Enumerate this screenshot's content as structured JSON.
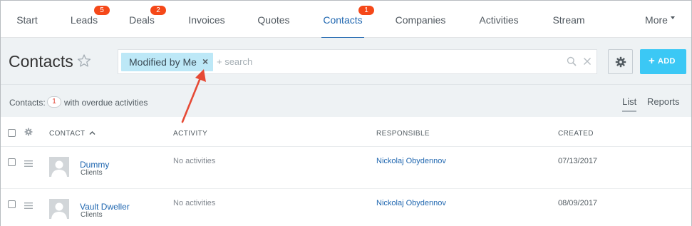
{
  "nav": {
    "items": [
      {
        "label": "Start"
      },
      {
        "label": "Leads",
        "badge": "5"
      },
      {
        "label": "Deals",
        "badge": "2"
      },
      {
        "label": "Invoices"
      },
      {
        "label": "Quotes"
      },
      {
        "label": "Contacts",
        "badge": "1",
        "active": true
      },
      {
        "label": "Companies"
      },
      {
        "label": "Activities"
      },
      {
        "label": "Stream"
      },
      {
        "label": "More"
      }
    ]
  },
  "header": {
    "title": "Contacts",
    "filter_chip": "Modified by Me",
    "search_placeholder": "+ search",
    "add_label": "ADD",
    "add_plus": "+"
  },
  "subbar": {
    "counter_prefix": "Contacts:",
    "counter_value": "1",
    "counter_suffix": "with overdue activities",
    "views": [
      "List",
      "Reports"
    ]
  },
  "table": {
    "columns": [
      "CONTACT",
      "ACTIVITY",
      "RESPONSIBLE",
      "CREATED"
    ],
    "rows": [
      {
        "name": "Dummy",
        "type": "Clients",
        "activity": "No activities",
        "responsible": "Nickolaj Obydennov",
        "created": "07/13/2017"
      },
      {
        "name": "Vault Dweller",
        "type": "Clients",
        "activity": "No activities",
        "responsible": "Nickolaj Obydennov",
        "created": "08/09/2017"
      }
    ]
  },
  "colors": {
    "accent": "#2067b0",
    "badge": "#f54819",
    "add_button": "#3bc8f5",
    "filter_chip": "#bde8f7",
    "annotation_arrow": "#e64a35"
  },
  "icons": {
    "favorite": "star-icon",
    "search": "search-icon",
    "clear": "close-icon",
    "settings": "gear-icon",
    "sort": "chevron-up-icon",
    "drag": "menu-icon",
    "avatar": "user-icon"
  }
}
